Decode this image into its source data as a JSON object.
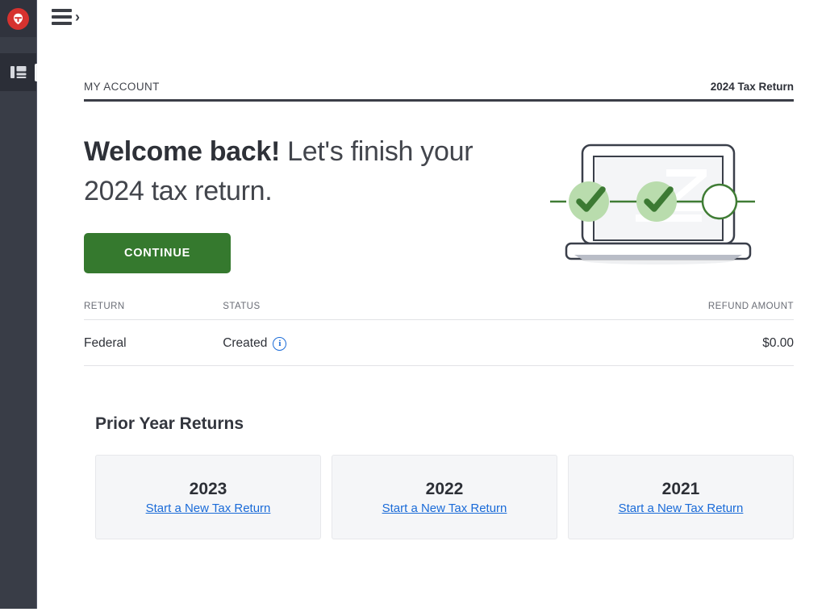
{
  "sidebar": {
    "logo_icon": "shield-helmet-logo",
    "items": [
      {
        "icon": "dashboard-layout-icon",
        "name": "dashboard"
      }
    ]
  },
  "topbar": {
    "menu_icon": "hamburger-menu-icon",
    "expand_icon": "chevron-right-icon"
  },
  "header": {
    "account_label": "MY ACCOUNT",
    "tax_year_label": "2024 Tax Return"
  },
  "hero": {
    "headline_bold": "Welcome back!",
    "headline_rest": " Let's finish your 2024 tax return.",
    "continue_label": "CONTINUE",
    "illustration": "laptop-progress-checkmarks",
    "accent_green": "#35792e",
    "check_green": "#3c7a33",
    "check_halo": "#b9dcad"
  },
  "returns_table": {
    "columns": [
      "RETURN",
      "STATUS",
      "REFUND AMOUNT"
    ],
    "rows": [
      {
        "return": "Federal",
        "status": "Created",
        "status_info_icon": "info-circle-icon",
        "refund_amount": "$0.00"
      }
    ]
  },
  "prior_year": {
    "title": "Prior Year Returns",
    "cards": [
      {
        "year": "2023",
        "link": "Start a New Tax Return"
      },
      {
        "year": "2022",
        "link": "Start a New Tax Return"
      },
      {
        "year": "2021",
        "link": "Start a New Tax Return"
      }
    ]
  },
  "colors": {
    "sidebar_bg": "#393d47",
    "sidebar_top_bg": "#30333d",
    "sidebar_active_bg": "#2b2e37",
    "link_blue": "#1a6bd8",
    "button_green": "#35792e"
  }
}
